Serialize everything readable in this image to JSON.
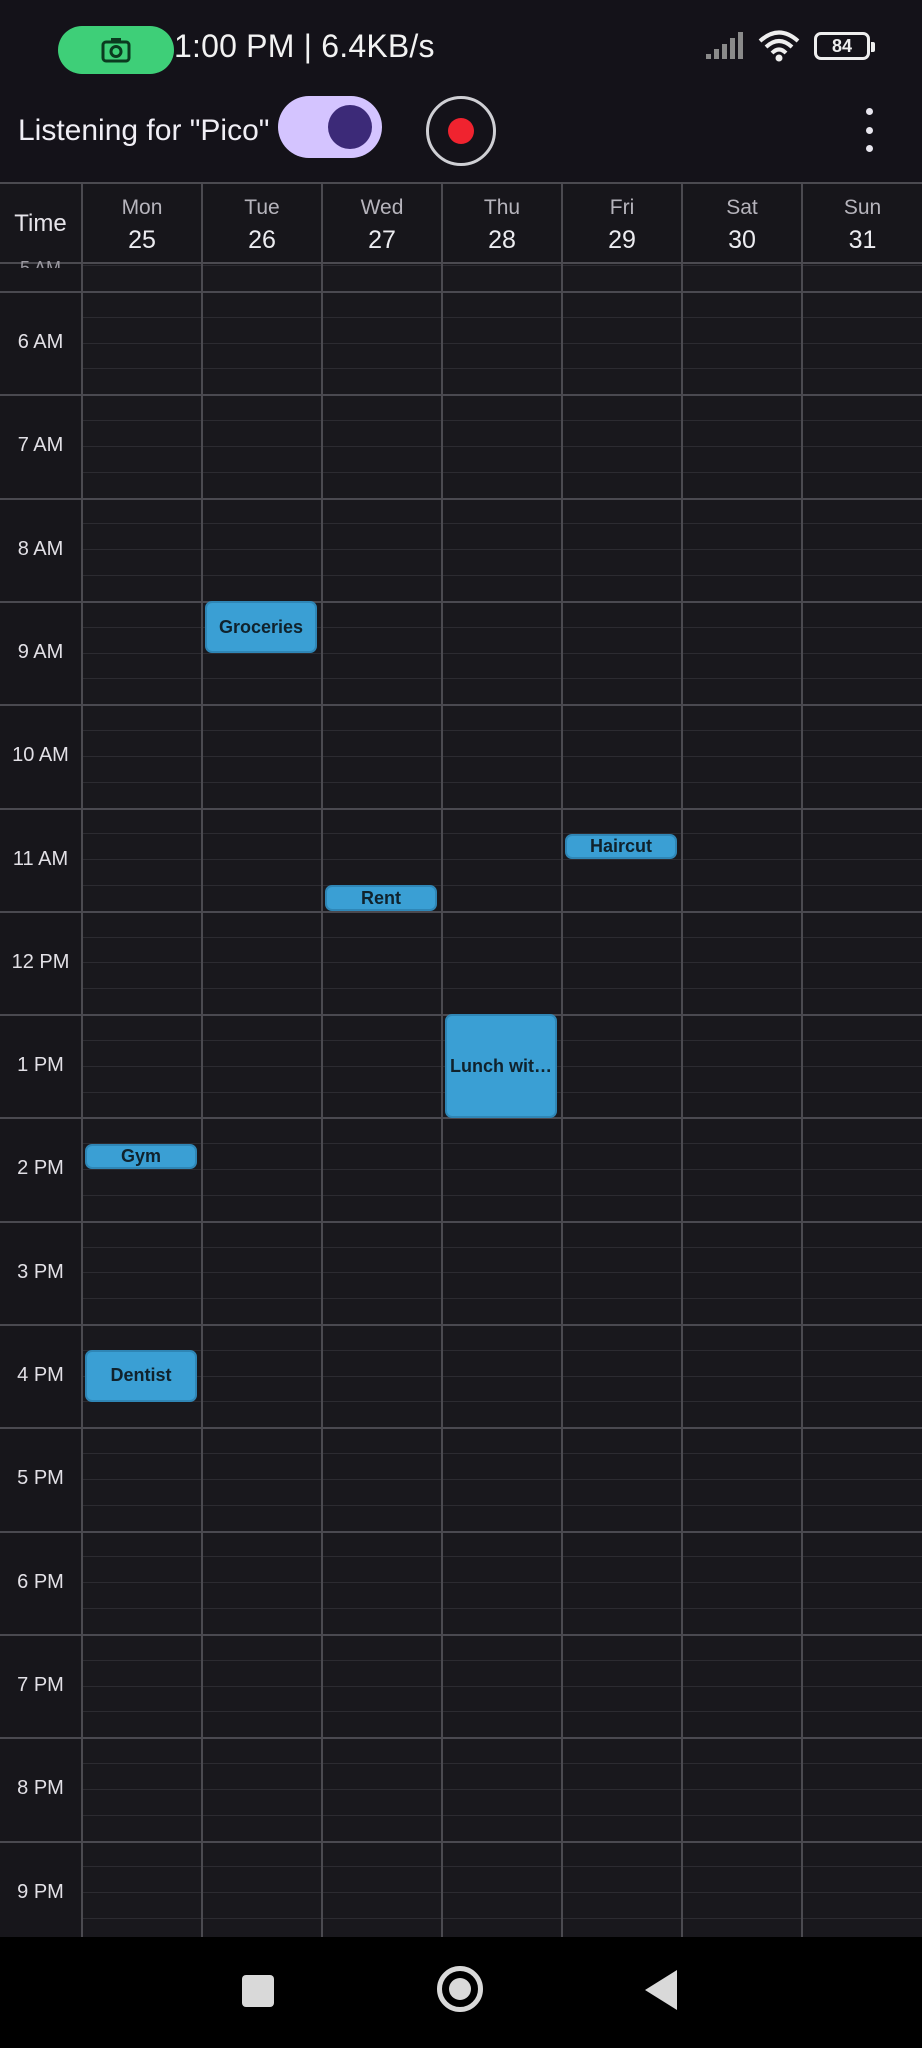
{
  "status_bar": {
    "time_speed": "1:00 PM | 6.4KB/s",
    "battery": "84",
    "icons": [
      "camera-icon",
      "signal-icon",
      "wifi-icon",
      "battery-icon"
    ]
  },
  "toolbar": {
    "listening_label": "Listening for \"Pico\"",
    "toggle_on": true,
    "colors": {
      "toggle_track": "#d4c4ff",
      "toggle_knob": "#3c2a78",
      "record_dot": "#f0232f"
    }
  },
  "calendar": {
    "time_header": "Time",
    "days": [
      {
        "dow": "Mon",
        "date": "25"
      },
      {
        "dow": "Tue",
        "date": "26"
      },
      {
        "dow": "Wed",
        "date": "27"
      },
      {
        "dow": "Thu",
        "date": "28"
      },
      {
        "dow": "Fri",
        "date": "29"
      },
      {
        "dow": "Sat",
        "date": "30"
      },
      {
        "dow": "Sun",
        "date": "31"
      }
    ],
    "hours": [
      "6 AM",
      "7 AM",
      "8 AM",
      "9 AM",
      "10 AM",
      "11 AM",
      "12 PM",
      "1 PM",
      "2 PM",
      "3 PM",
      "4 PM",
      "5 PM",
      "6 PM",
      "7 PM",
      "8 PM",
      "9 PM"
    ],
    "events": [
      {
        "title": "Groceries",
        "day": "Tue",
        "start": "8:30 AM",
        "end": "9:00 AM"
      },
      {
        "title": "Haircut",
        "day": "Fri",
        "start": "10:45 AM",
        "end": "11:00 AM"
      },
      {
        "title": "Rent",
        "day": "Wed",
        "start": "11:15 AM",
        "end": "11:30 AM"
      },
      {
        "title": "Lunch wit…",
        "day": "Thu",
        "start": "12:30 PM",
        "end": "1:30 PM"
      },
      {
        "title": "Gym",
        "day": "Mon",
        "start": "1:45 PM",
        "end": "2:00 PM"
      },
      {
        "title": "Dentist",
        "day": "Mon",
        "start": "3:45 PM",
        "end": "4:15 PM"
      }
    ],
    "event_color": "#3a9fd4"
  },
  "nav_bar": {
    "icons": [
      "recents-square-icon",
      "home-circle-icon",
      "back-triangle-icon"
    ]
  }
}
